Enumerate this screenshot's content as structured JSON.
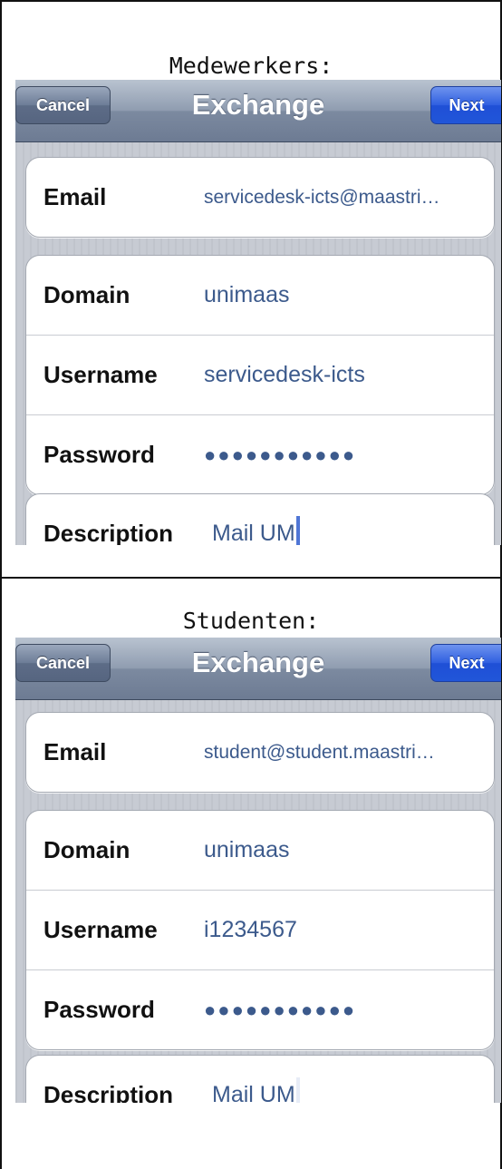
{
  "sections": [
    {
      "caption": "Medewerkers:",
      "nav": {
        "cancel": "Cancel",
        "title": "Exchange",
        "next": "Next"
      },
      "email": {
        "label": "Email",
        "value": "servicedesk-icts@maastri…"
      },
      "domain": {
        "label": "Domain",
        "value": "unimaas"
      },
      "username": {
        "label": "Username",
        "value": "servicedesk-icts"
      },
      "password": {
        "label": "Password",
        "value": "●●●●●●●●●●●"
      },
      "description": {
        "label": "Description",
        "value": "Mail UM"
      }
    },
    {
      "caption": "Studenten:",
      "nav": {
        "cancel": "Cancel",
        "title": "Exchange",
        "next": "Next"
      },
      "email": {
        "label": "Email",
        "value": "student@student.maastri…"
      },
      "domain": {
        "label": "Domain",
        "value": "unimaas"
      },
      "username": {
        "label": "Username",
        "value": "i1234567"
      },
      "password": {
        "label": "Password",
        "value": "●●●●●●●●●●●"
      },
      "description": {
        "label": "Description",
        "value": "Mail UM"
      }
    }
  ],
  "colors": {
    "field_value": "#3c5a8c",
    "next_button": "#2156d9",
    "nav_bar": "#7c8aa0",
    "background": "#c7cbd3"
  }
}
